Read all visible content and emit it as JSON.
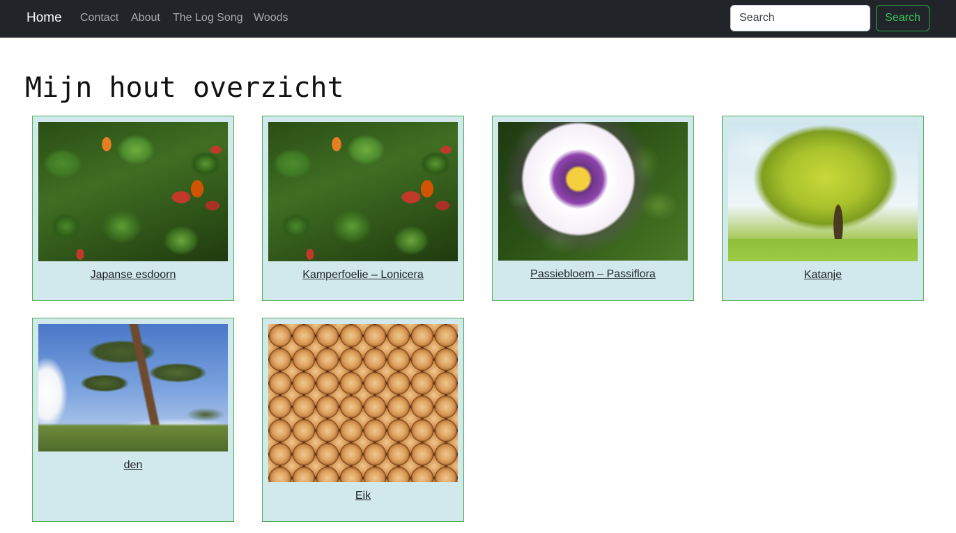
{
  "navbar": {
    "brand": "Home",
    "links": [
      "Contact",
      "About",
      "The Log Song",
      "Woods"
    ],
    "search": {
      "placeholder": "Search",
      "button_label": "Search"
    }
  },
  "main": {
    "title": "Mijn hout overzicht",
    "cards": [
      {
        "label": "Japanse esdoorn",
        "image": "honeysuckle-flowers-photo"
      },
      {
        "label": "Kamperfoelie – Lonicera",
        "image": "honeysuckle-flowers-photo"
      },
      {
        "label": "Passiebloem – Passiflora",
        "image": "passion-flower-photo"
      },
      {
        "label": "Katanje",
        "image": "green-tree-photo"
      },
      {
        "label": "den",
        "image": "pine-tree-photo"
      },
      {
        "label": "Eik",
        "image": "stacked-logs-photo"
      }
    ]
  },
  "colors": {
    "navbar_bg": "#212529",
    "card_bg": "#d1e8ec",
    "card_border": "#4caf50",
    "search_button": "#28a745"
  }
}
